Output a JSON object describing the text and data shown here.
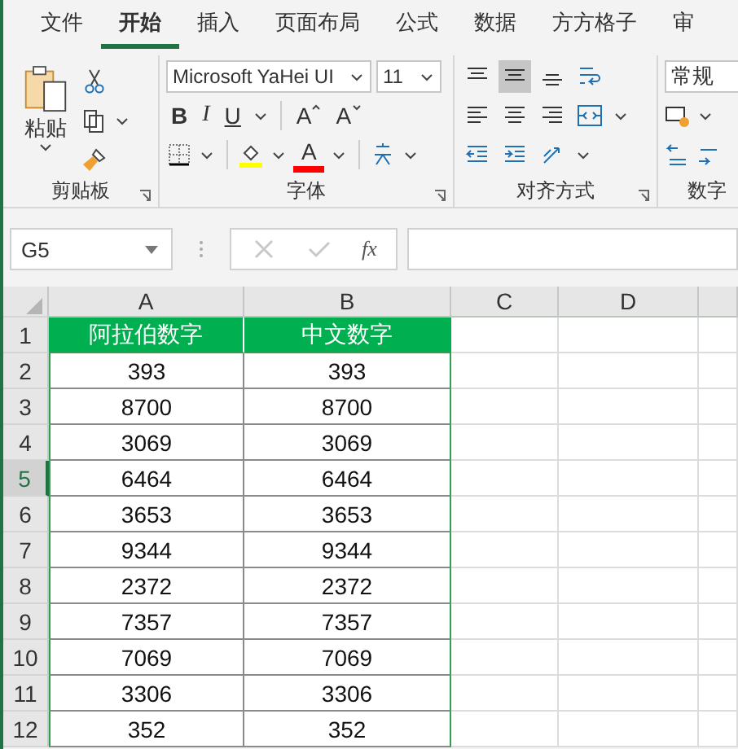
{
  "tabs": [
    {
      "label": "文件",
      "selected": false
    },
    {
      "label": "开始",
      "selected": true
    },
    {
      "label": "插入",
      "selected": false
    },
    {
      "label": "页面布局",
      "selected": false
    },
    {
      "label": "公式",
      "selected": false
    },
    {
      "label": "数据",
      "selected": false
    },
    {
      "label": "方方格子",
      "selected": false
    },
    {
      "label": "审",
      "selected": false
    }
  ],
  "clipboard": {
    "paste_label": "粘贴",
    "group_label": "剪贴板"
  },
  "font": {
    "font_name": "Microsoft YaHei UI",
    "font_size": "11",
    "bold": "B",
    "italic": "I",
    "underline": "U",
    "grow": "A",
    "shrink": "A",
    "font_color": "A",
    "group_label": "字体"
  },
  "alignment": {
    "buttons": [
      {
        "kind": "top",
        "selected": false
      },
      {
        "kind": "middle",
        "selected": true
      },
      {
        "kind": "bottom",
        "selected": false
      },
      {
        "kind": "wrap",
        "selected": false
      },
      {
        "kind": "left",
        "selected": false
      },
      {
        "kind": "center",
        "selected": false
      },
      {
        "kind": "right",
        "selected": false
      },
      {
        "kind": "merge",
        "selected": false
      },
      {
        "kind": "outdent",
        "selected": false
      },
      {
        "kind": "indent",
        "selected": false
      },
      {
        "kind": "orient",
        "selected": false
      }
    ],
    "group_label": "对齐方式"
  },
  "number": {
    "format": "常规",
    "group_label": "数字"
  },
  "formula_bar": {
    "name_box": "G5",
    "function_label": "fx"
  },
  "columns": [
    "A",
    "B",
    "C",
    "D"
  ],
  "rows": [
    {
      "header": "1",
      "kind": "header",
      "selected": false,
      "cells": [
        "阿拉伯数字",
        "中文数字"
      ]
    },
    {
      "header": "2",
      "kind": "data",
      "selected": false,
      "cells": [
        "393",
        "393"
      ]
    },
    {
      "header": "3",
      "kind": "data",
      "selected": false,
      "cells": [
        "8700",
        "8700"
      ]
    },
    {
      "header": "4",
      "kind": "data",
      "selected": false,
      "cells": [
        "3069",
        "3069"
      ]
    },
    {
      "header": "5",
      "kind": "data",
      "selected": true,
      "cells": [
        "6464",
        "6464"
      ]
    },
    {
      "header": "6",
      "kind": "data",
      "selected": false,
      "cells": [
        "3653",
        "3653"
      ]
    },
    {
      "header": "7",
      "kind": "data",
      "selected": false,
      "cells": [
        "9344",
        "9344"
      ]
    },
    {
      "header": "8",
      "kind": "data",
      "selected": false,
      "cells": [
        "2372",
        "2372"
      ]
    },
    {
      "header": "9",
      "kind": "data",
      "selected": false,
      "cells": [
        "7357",
        "7357"
      ]
    },
    {
      "header": "10",
      "kind": "data",
      "selected": false,
      "cells": [
        "7069",
        "7069"
      ]
    },
    {
      "header": "11",
      "kind": "data",
      "selected": false,
      "cells": [
        "3306",
        "3306"
      ]
    },
    {
      "header": "12",
      "kind": "data",
      "selected": false,
      "cells": [
        "352",
        "352"
      ]
    }
  ]
}
